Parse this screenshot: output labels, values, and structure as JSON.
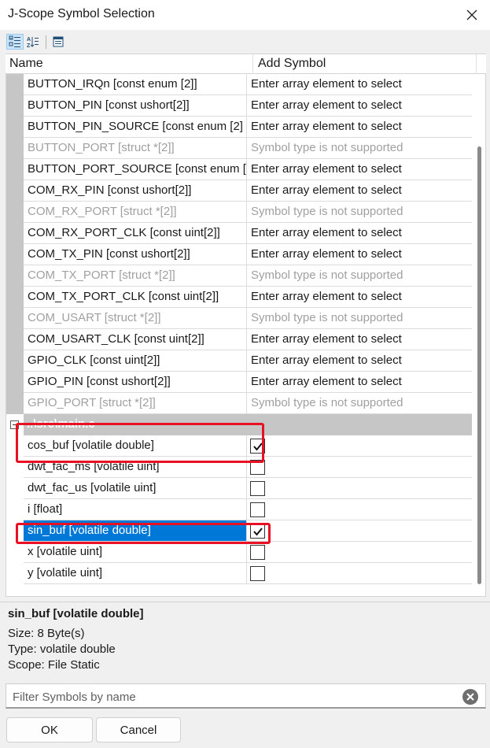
{
  "window": {
    "title": "J-Scope Symbol Selection"
  },
  "toolbar": {
    "icons": [
      "categorized-view-icon",
      "alphabetical-sort-icon",
      "property-pages-icon"
    ]
  },
  "columns": {
    "name": "Name",
    "add_symbol": "Add Symbol"
  },
  "groups": [
    {
      "label": "",
      "rows": [
        {
          "name": "BUTTON_IRQn [const enum [2]]",
          "value": "Enter array element to select",
          "supported": true
        },
        {
          "name": "BUTTON_PIN [const ushort[2]]",
          "value": "Enter array element to select",
          "supported": true
        },
        {
          "name": "BUTTON_PIN_SOURCE [const enum [2]",
          "value": "Enter array element to select",
          "supported": true
        },
        {
          "name": "BUTTON_PORT [struct *[2]]",
          "value": "Symbol type is not supported",
          "supported": false
        },
        {
          "name": "BUTTON_PORT_SOURCE [const enum [",
          "value": "Enter array element to select",
          "supported": true
        },
        {
          "name": "COM_RX_PIN [const ushort[2]]",
          "value": "Enter array element to select",
          "supported": true
        },
        {
          "name": "COM_RX_PORT [struct *[2]]",
          "value": "Symbol type is not supported",
          "supported": false
        },
        {
          "name": "COM_RX_PORT_CLK [const uint[2]]",
          "value": "Enter array element to select",
          "supported": true
        },
        {
          "name": "COM_TX_PIN [const ushort[2]]",
          "value": "Enter array element to select",
          "supported": true
        },
        {
          "name": "COM_TX_PORT [struct *[2]]",
          "value": "Symbol type is not supported",
          "supported": false
        },
        {
          "name": "COM_TX_PORT_CLK [const uint[2]]",
          "value": "Enter array element to select",
          "supported": true
        },
        {
          "name": "COM_USART [struct *[2]]",
          "value": "Symbol type is not supported",
          "supported": false
        },
        {
          "name": "COM_USART_CLK [const uint[2]]",
          "value": "Enter array element to select",
          "supported": true
        },
        {
          "name": "GPIO_CLK [const uint[2]]",
          "value": "Enter array element to select",
          "supported": true
        },
        {
          "name": "GPIO_PIN [const ushort[2]]",
          "value": "Enter array element to select",
          "supported": true
        },
        {
          "name": "GPIO_PORT [struct *[2]]",
          "value": "Symbol type is not supported",
          "supported": false
        }
      ]
    },
    {
      "label": "..\\src\\main.c",
      "rows": [
        {
          "name": "cos_buf [volatile double]",
          "checked": true,
          "selected": false,
          "highlighted": true
        },
        {
          "name": "dwt_fac_ms [volatile uint]",
          "checked": false,
          "selected": false,
          "highlighted": false
        },
        {
          "name": "dwt_fac_us [volatile uint]",
          "checked": false,
          "selected": false,
          "highlighted": false
        },
        {
          "name": "i [float]",
          "checked": false,
          "selected": false,
          "highlighted": false
        },
        {
          "name": "sin_buf [volatile double]",
          "checked": true,
          "selected": true,
          "highlighted": true
        },
        {
          "name": "x [volatile uint]",
          "checked": false,
          "selected": false,
          "highlighted": false
        },
        {
          "name": "y [volatile uint]",
          "checked": false,
          "selected": false,
          "highlighted": false
        }
      ]
    }
  ],
  "details": {
    "title": "sin_buf [volatile double]",
    "size": "Size:  8 Byte(s)",
    "type": "Type:  volatile double",
    "scope": "Scope:  File Static"
  },
  "filter": {
    "placeholder": "Filter Symbols by name",
    "value": ""
  },
  "buttons": {
    "ok": "OK",
    "cancel": "Cancel"
  },
  "colors": {
    "selection": "#0078d7",
    "highlight_box": "#e81123",
    "group_bar": "#c6c6c6",
    "disabled_text": "#a0a0a0"
  }
}
